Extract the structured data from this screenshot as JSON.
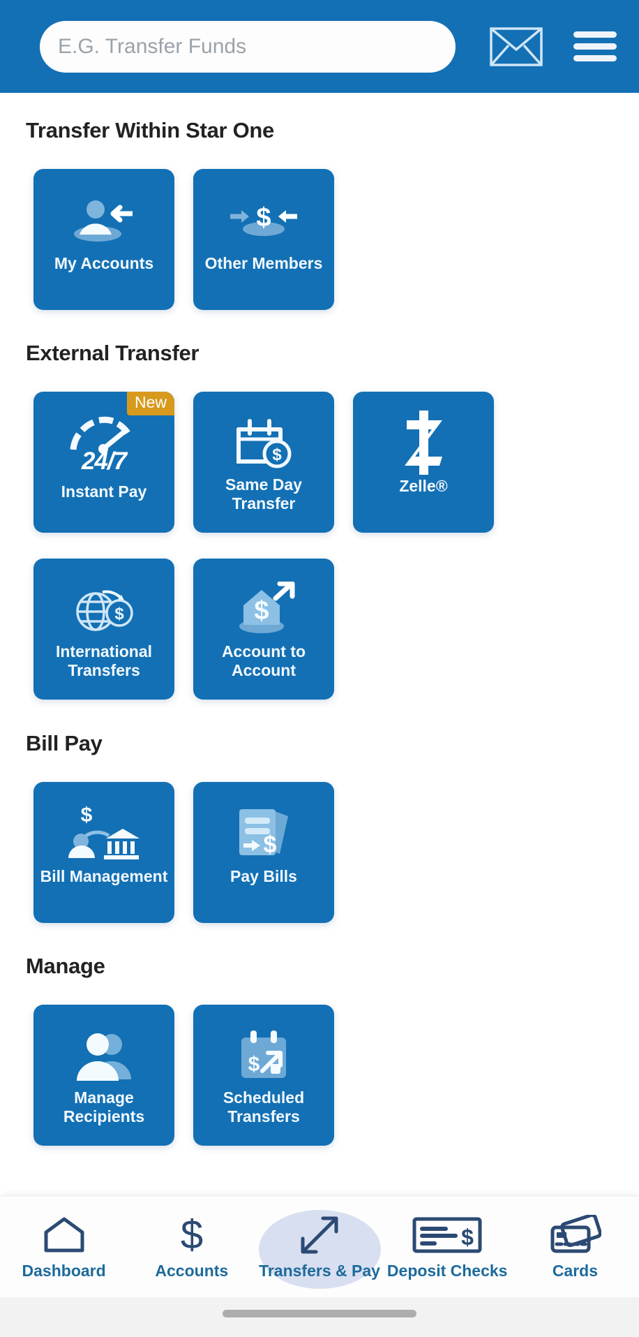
{
  "header": {
    "search": {
      "placeholder": "E.G. Transfer Funds",
      "value": ""
    },
    "mail_icon": "envelope-icon",
    "menu_icon": "hamburger-menu-icon"
  },
  "sections": [
    {
      "id": "transfer-within-star-one",
      "title": "Transfer Within Star One",
      "rows": [
        [
          {
            "id": "my-accounts",
            "label": "My Accounts",
            "icon": "person-arrow-left-icon",
            "badge": null
          },
          {
            "id": "other-members",
            "label": "Other Members",
            "icon": "dollar-arrows-icon",
            "badge": null
          }
        ]
      ]
    },
    {
      "id": "external-transfer",
      "title": "External Transfer",
      "rows": [
        [
          {
            "id": "instant-pay",
            "label": "Instant Pay",
            "icon": "speedometer-icon",
            "badge": "New",
            "icon_text": "24/7"
          },
          {
            "id": "same-day-transfer",
            "label": "Same Day Transfer",
            "icon": "calendar-dollar-icon",
            "badge": null
          },
          {
            "id": "zelle",
            "label": "Zelle®",
            "icon": "zelle-logo-icon",
            "badge": null
          }
        ],
        [
          {
            "id": "international-transfers",
            "label": "International Transfers",
            "icon": "globe-dollar-icon",
            "badge": null
          },
          {
            "id": "account-to-account",
            "label": "Account to Account",
            "icon": "bank-arrow-up-icon",
            "badge": null
          }
        ]
      ]
    },
    {
      "id": "bill-pay",
      "title": "Bill Pay",
      "rows": [
        [
          {
            "id": "bill-management",
            "label": "Bill Management",
            "icon": "person-to-bank-icon",
            "badge": null
          },
          {
            "id": "pay-bills",
            "label": "Pay Bills",
            "icon": "documents-dollar-icon",
            "badge": null
          }
        ]
      ]
    },
    {
      "id": "manage",
      "title": "Manage",
      "rows": [
        [
          {
            "id": "manage-recipients",
            "label": "Manage Recipients",
            "icon": "people-group-icon",
            "badge": null
          },
          {
            "id": "scheduled-transfers",
            "label": "Scheduled Transfers",
            "icon": "calendar-arrow-icon",
            "badge": null
          }
        ]
      ]
    }
  ],
  "bottom_nav": {
    "active": "transfers-and-pay",
    "items": [
      {
        "id": "dashboard",
        "label": "Dashboard",
        "icon": "home-icon"
      },
      {
        "id": "accounts",
        "label": "Accounts",
        "icon": "dollar-sign-icon"
      },
      {
        "id": "transfers-pay",
        "label": "Transfers & Pay",
        "icon": "diagonal-arrows-icon"
      },
      {
        "id": "deposit-checks",
        "label": "Deposit Checks",
        "icon": "check-icon"
      },
      {
        "id": "cards",
        "label": "Cards",
        "icon": "credit-cards-icon"
      }
    ]
  },
  "colors": {
    "brand_blue": "#1470b5",
    "tile_blue": "#1370b4",
    "badge_orange": "#d79a1d",
    "nav_label": "#1d6a9c",
    "nav_icon": "#2b4a73",
    "nav_active_pill": "#d8dff0"
  }
}
